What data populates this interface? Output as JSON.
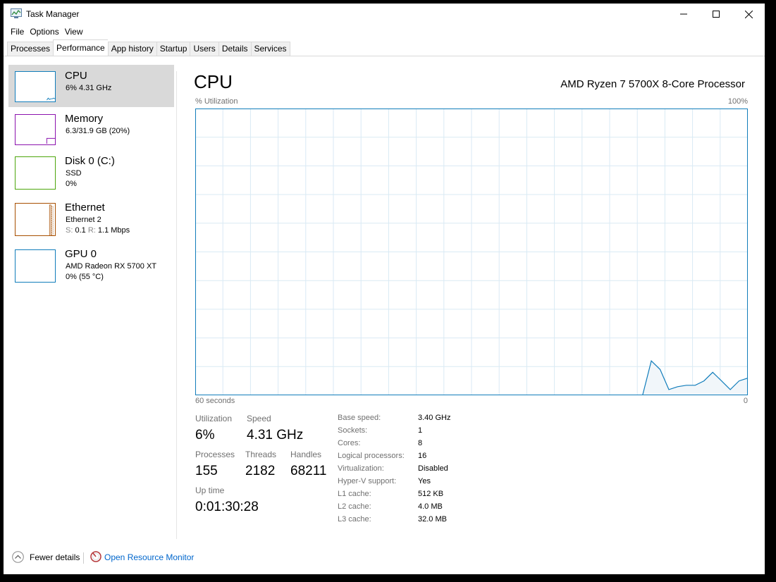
{
  "window": {
    "title": "Task Manager"
  },
  "menu": [
    "File",
    "Options",
    "View"
  ],
  "tabs": [
    "Processes",
    "Performance",
    "App history",
    "Startup",
    "Users",
    "Details",
    "Services"
  ],
  "active_tab": "Performance",
  "sidebar": {
    "items": [
      {
        "title": "CPU",
        "lines": [
          "6% 4.31 GHz"
        ],
        "color": "#117dbb"
      },
      {
        "title": "Memory",
        "lines": [
          "6.3/31.9 GB (20%)"
        ],
        "color": "#8b12ae"
      },
      {
        "title": "Disk 0 (C:)",
        "lines": [
          "SSD",
          "0%"
        ],
        "color": "#4da60c"
      },
      {
        "title": "Ethernet",
        "lines": [
          "Ethernet 2"
        ],
        "net": {
          "s_label": "S:",
          "s_value": "0.1",
          "r_label": "R:",
          "r_value": "1.1 Mbps"
        },
        "color": "#a74f01"
      },
      {
        "title": "GPU 0",
        "lines": [
          "AMD Radeon RX 5700 XT",
          "0%  (55 °C)"
        ],
        "color": "#117dbb"
      }
    ]
  },
  "main": {
    "title": "CPU",
    "processor": "AMD Ryzen 7 5700X 8-Core Processor",
    "graph": {
      "ylabel": "% Utilization",
      "ymax_label": "100%",
      "xlabel": "60 seconds",
      "xmin_label": "0",
      "line_color": "#117dbb",
      "fill_color": "#f1f6fa",
      "grid_color": "#d9eaf4",
      "series": [
        0,
        0,
        0,
        0,
        0,
        0,
        0,
        0,
        0,
        0,
        0,
        0,
        0,
        0,
        0,
        0,
        0,
        0,
        0,
        0,
        0,
        0,
        0,
        0,
        0,
        0,
        0,
        0,
        0,
        0,
        0,
        0,
        0,
        0,
        0,
        0,
        0,
        0,
        0,
        0,
        0,
        0,
        0,
        0,
        0,
        0,
        0,
        0,
        0,
        0,
        0,
        0,
        12,
        9,
        2,
        3,
        3.5,
        3.5,
        5,
        8,
        5,
        2,
        5,
        6
      ]
    },
    "stats": {
      "utilization_label": "Utilization",
      "utilization": "6%",
      "speed_label": "Speed",
      "speed": "4.31 GHz",
      "processes_label": "Processes",
      "processes": "155",
      "threads_label": "Threads",
      "threads": "2182",
      "handles_label": "Handles",
      "handles": "68211",
      "uptime_label": "Up time",
      "uptime": "0:01:30:28"
    },
    "specs": [
      {
        "k": "Base speed:",
        "v": "3.40 GHz"
      },
      {
        "k": "Sockets:",
        "v": "1"
      },
      {
        "k": "Cores:",
        "v": "8"
      },
      {
        "k": "Logical processors:",
        "v": "16"
      },
      {
        "k": "Virtualization:",
        "v": "Disabled"
      },
      {
        "k": "Hyper-V support:",
        "v": "Yes"
      },
      {
        "k": "L1 cache:",
        "v": "512 KB"
      },
      {
        "k": "L2 cache:",
        "v": "4.0 MB"
      },
      {
        "k": "L3 cache:",
        "v": "32.0 MB"
      }
    ]
  },
  "footer": {
    "fewer_details": "Fewer details",
    "open_resource_monitor": "Open Resource Monitor"
  }
}
